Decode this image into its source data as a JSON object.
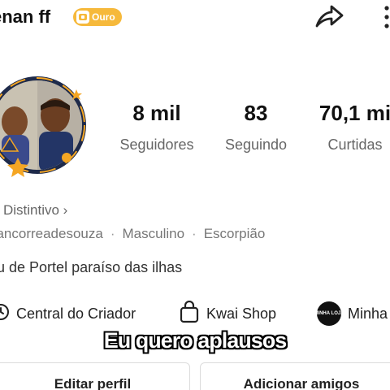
{
  "profile": {
    "username": "enan ff",
    "badge_label": "Ouro"
  },
  "stats": [
    {
      "value": "8 mil",
      "label": "Seguidores"
    },
    {
      "value": "83",
      "label": "Seguindo"
    },
    {
      "value": "70,1 mi",
      "label": "Curtidas"
    }
  ],
  "info": {
    "distintivo": "Distintivo ›",
    "tags": [
      "nancorreadesouza",
      "Masculino",
      "Escorpião"
    ],
    "bio": "ou de Portel paraíso das ilhas"
  },
  "links": [
    {
      "label": "Central do Criador",
      "icon": "creator-center-icon"
    },
    {
      "label": "Kwai Shop",
      "icon": "shopping-bag-icon"
    },
    {
      "label": "Minha",
      "icon": "minha-logo",
      "logo_text": "MINHA LOJA"
    }
  ],
  "caption": "Eu quero aplausos",
  "buttons": {
    "edit": "Editar perfil",
    "add_friends": "Adicionar amigos"
  },
  "colors": {
    "badge": "#f6b93b",
    "avatar_ring": "#1e2a4a",
    "star": "#f5a623"
  }
}
